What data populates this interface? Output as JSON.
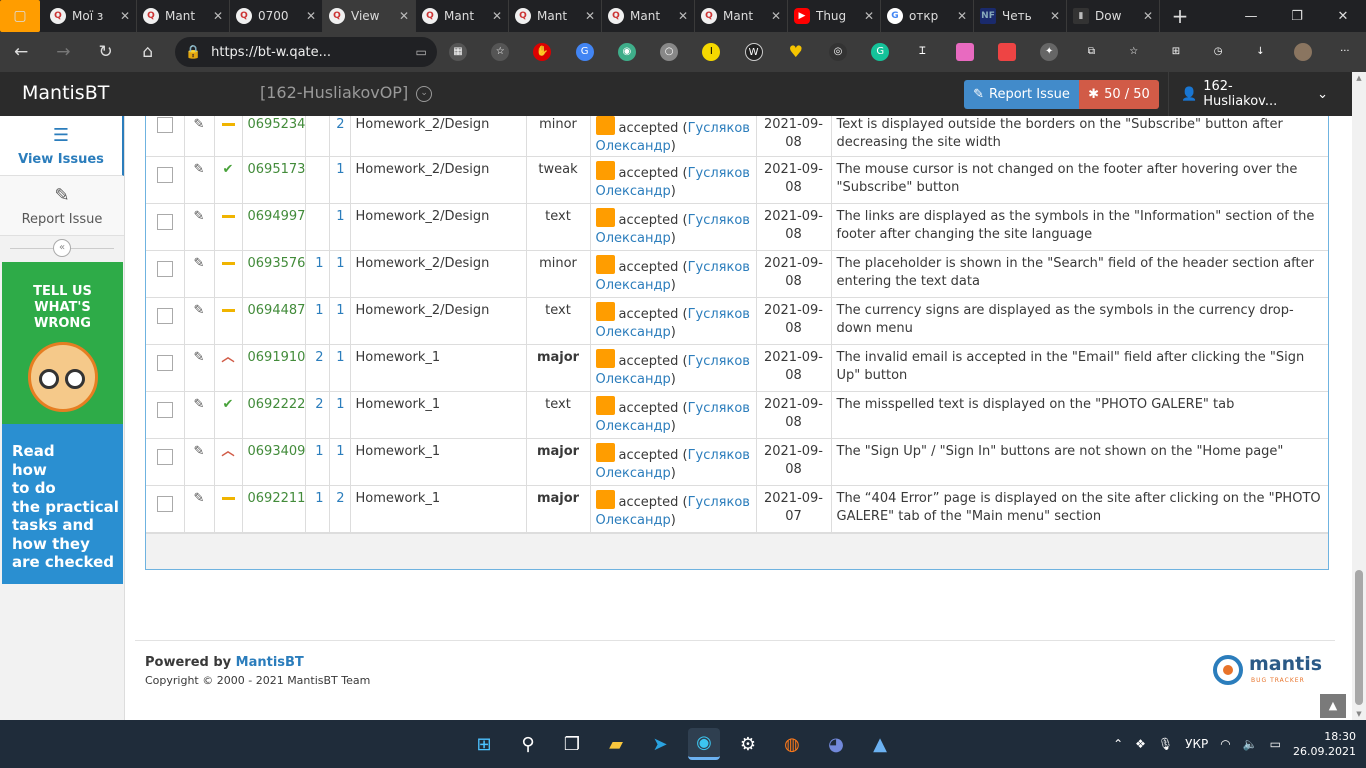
{
  "browser": {
    "tabs": [
      {
        "title": "Мої з",
        "icon": "Q"
      },
      {
        "title": "Mant",
        "icon": "Q"
      },
      {
        "title": "0700",
        "icon": "Q"
      },
      {
        "title": "View",
        "icon": "Q",
        "active": true
      },
      {
        "title": "Mant",
        "icon": "Q"
      },
      {
        "title": "Mant",
        "icon": "Q"
      },
      {
        "title": "Mant",
        "icon": "Q"
      },
      {
        "title": "Mant",
        "icon": "Q"
      },
      {
        "title": "Thug",
        "icon": "▶"
      },
      {
        "title": "откр",
        "icon": "G"
      },
      {
        "title": "Четь",
        "icon": "NF"
      },
      {
        "title": "Dow",
        "icon": "▮"
      }
    ],
    "url": "https://bt-w.qate..."
  },
  "navbar": {
    "brand": "MantisBT",
    "project": "[162-HusliakovOP]",
    "report_issue": "Report Issue",
    "issue_count": "50 / 50",
    "user": "162-Husliakov..."
  },
  "sidebar": {
    "view_issues": "View Issues",
    "report_issue": "Report Issue",
    "ad1_text": "TELL US WHAT'S WRONG",
    "ad2_lines": [
      "Read",
      "how",
      "to do",
      "the practical",
      "tasks and",
      "how they",
      "are checked"
    ]
  },
  "issues": [
    {
      "priority": "normal",
      "id": "0695234",
      "notes": "",
      "attach": "2",
      "category": "Homework_2/Design",
      "severity": "minor",
      "severity_bold": false,
      "status": "accepted",
      "handler": "Гусляков Олександр",
      "date1": "2021-09-",
      "date2": "08",
      "summary": "Text is displayed outside the borders on the \"Subscribe\" button after decreasing the site width"
    },
    {
      "priority": "low",
      "id": "0695173",
      "notes": "",
      "attach": "1",
      "category": "Homework_2/Design",
      "severity": "tweak",
      "severity_bold": false,
      "status": "accepted",
      "handler": "Гусляков Олександр",
      "date1": "2021-09-",
      "date2": "08",
      "summary": "The mouse cursor is not changed on the footer after hovering over the \"Subscribe\" button"
    },
    {
      "priority": "normal",
      "id": "0694997",
      "notes": "",
      "attach": "1",
      "category": "Homework_2/Design",
      "severity": "text",
      "severity_bold": false,
      "status": "accepted",
      "handler": "Гусляков Олександр",
      "date1": "2021-09-",
      "date2": "08",
      "summary": "The links are displayed as the symbols in the \"Information\" section of the footer after changing the site language"
    },
    {
      "priority": "normal",
      "id": "0693576",
      "notes": "1",
      "attach": "1",
      "category": "Homework_2/Design",
      "severity": "minor",
      "severity_bold": false,
      "status": "accepted",
      "handler": "Гусляков Олександр",
      "date1": "2021-09-",
      "date2": "08",
      "summary": "The placeholder is shown in the \"Search\" field of the header section after entering the text data"
    },
    {
      "priority": "normal",
      "id": "0694487",
      "notes": "1",
      "attach": "1",
      "category": "Homework_2/Design",
      "severity": "text",
      "severity_bold": false,
      "status": "accepted",
      "handler": "Гусляков Олександр",
      "date1": "2021-09-",
      "date2": "08",
      "summary": "The currency signs are displayed as the symbols in the currency drop-down menu"
    },
    {
      "priority": "high",
      "id": "0691910",
      "notes": "2",
      "attach": "1",
      "category": "Homework_1",
      "severity": "major",
      "severity_bold": true,
      "status": "accepted",
      "handler": "Гусляков Олександр",
      "date1": "2021-09-",
      "date2": "08",
      "summary": "The invalid email is accepted in the \"Email\" field after clicking the \"Sign Up\" button"
    },
    {
      "priority": "low",
      "id": "0692222",
      "notes": "2",
      "attach": "1",
      "category": "Homework_1",
      "severity": "text",
      "severity_bold": false,
      "status": "accepted",
      "handler": "Гусляков Олександр",
      "date1": "2021-09-",
      "date2": "08",
      "summary": "The misspelled text is displayed on the \"PHOTO GALERE\" tab"
    },
    {
      "priority": "high",
      "id": "0693409",
      "notes": "1",
      "attach": "1",
      "category": "Homework_1",
      "severity": "major",
      "severity_bold": true,
      "status": "accepted",
      "handler": "Гусляков Олександр",
      "date1": "2021-09-",
      "date2": "08",
      "summary": "The \"Sign Up\" / \"Sign In\" buttons are not shown on the \"Home page\""
    },
    {
      "priority": "normal",
      "id": "0692211",
      "notes": "1",
      "attach": "2",
      "category": "Homework_1",
      "severity": "major",
      "severity_bold": true,
      "status": "accepted",
      "handler": "Гусляков Олександр",
      "date1": "2021-09-",
      "date2": "07",
      "summary": "The “404 Error” page is displayed on the site after clicking on the \"PHOTO GALERE\" tab of the \"Main menu\" section"
    }
  ],
  "footer": {
    "powered_prefix": "Powered by",
    "powered_link": "MantisBT",
    "copyright": "Copyright © 2000 - 2021 MantisBT Team",
    "logo_text": "mantis",
    "logo_sub": "BUG TRACKER"
  },
  "taskbar": {
    "lang": "УКР",
    "time": "18:30",
    "date": "26.09.2021"
  },
  "colors": {
    "accent": "#2b7dbc",
    "report_btn": "#428bca",
    "count_btn": "#d15b47",
    "status_accepted": "#ff9d00",
    "navbar": "#2b2b2b"
  }
}
